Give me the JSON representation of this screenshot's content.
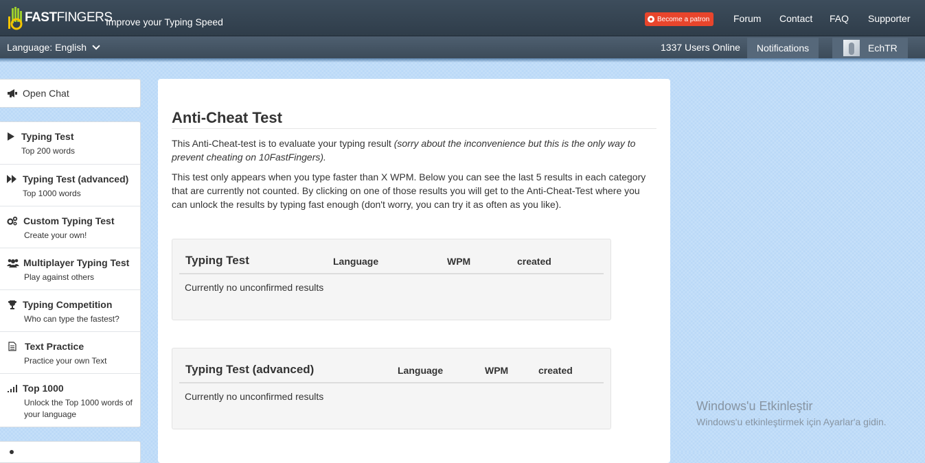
{
  "header": {
    "logo_prefix": "10",
    "logo_fast": "FAST",
    "logo_fingers": "FINGERS",
    "tagline": "Improve your Typing Speed",
    "patron_label": "Become a patron",
    "nav": [
      "Forum",
      "Contact",
      "FAQ",
      "Supporter"
    ]
  },
  "subbar": {
    "language_label": "Language: English",
    "users_online": "1337 Users Online",
    "notifications_label": "Notifications",
    "username": "EchTR"
  },
  "sidebar": {
    "open_chat": "Open Chat",
    "items": [
      {
        "title": "Typing Test",
        "sub": "Top 200 words",
        "icon": "play-icon"
      },
      {
        "title": "Typing Test (advanced)",
        "sub": "Top 1000 words",
        "icon": "fast-forward-icon"
      },
      {
        "title": "Custom Typing Test",
        "sub": "Create your own!",
        "icon": "cogs-icon"
      },
      {
        "title": "Multiplayer Typing Test",
        "sub": "Play against others",
        "icon": "users-icon"
      },
      {
        "title": "Typing Competition",
        "sub": "Who can type the fastest?",
        "icon": "trophy-icon"
      },
      {
        "title": "Text Practice",
        "sub": "Practice your own Text",
        "icon": "document-icon"
      },
      {
        "title": "Top 1000",
        "sub": "Unlock the Top 1000 words of your language",
        "icon": "signal-bars-icon"
      }
    ]
  },
  "main": {
    "title": "Anti-Cheat Test",
    "intro_plain": "This Anti-Cheat-test is to evaluate your typing result ",
    "intro_italic": "(sorry about the inconvenience but this is the only way to prevent cheating on 10FastFingers).",
    "description": "This test only appears when you type faster than X WPM. Below you can see the last 5 results in each category that are currently not counted. By clicking on one of those results you will get to the Anti-Cheat-Test where you can unlock the results by typing fast enough (don't worry, you can try it as often as you like).",
    "tables": [
      {
        "title": "Typing Test",
        "col_language": "Language",
        "col_wpm": "WPM",
        "col_created": "created",
        "empty": "Currently no unconfirmed results"
      },
      {
        "title": "Typing Test (advanced)",
        "col_language": "Language",
        "col_wpm": "WPM",
        "col_created": "created",
        "empty": "Currently no unconfirmed results"
      }
    ]
  },
  "watermark": {
    "line1": "Windows'u Etkinleştir",
    "line2": "Windows'u etkinleştirmek için Ayarlar'a gidin."
  }
}
